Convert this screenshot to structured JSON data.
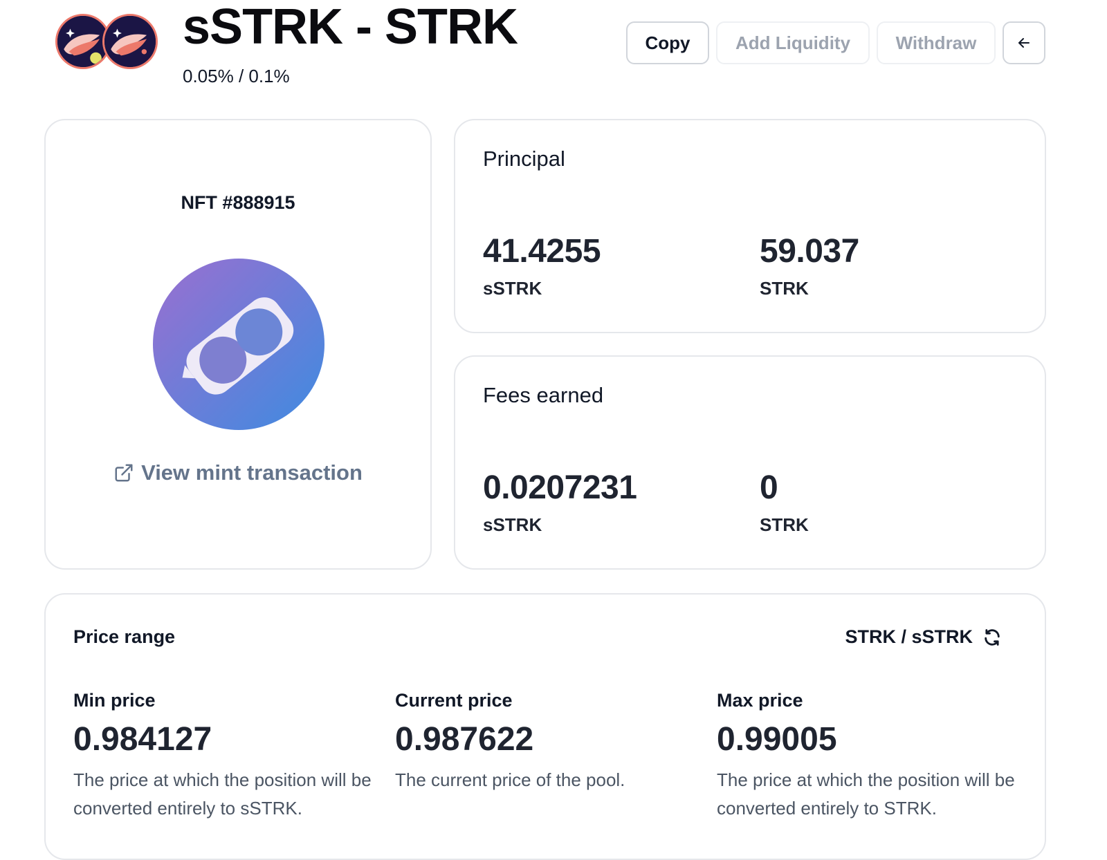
{
  "header": {
    "tokens": [
      {
        "name": "xSTRK-logo-icon"
      },
      {
        "name": "STRK-logo-icon"
      }
    ],
    "pair_title": "sSTRK - STRK",
    "fee_tier": "0.05% / 0.1%",
    "actions": {
      "copy": "Copy",
      "add_liquidity": "Add Liquidity",
      "withdraw": "Withdraw",
      "back_icon": "arrow-left-icon"
    }
  },
  "nft": {
    "title": "NFT #888915",
    "mint_link": "View mint transaction",
    "link_icon": "external-link-icon"
  },
  "principal": {
    "title": "Principal",
    "token_a": {
      "amount": "41.4255",
      "symbol": "sSTRK"
    },
    "token_b": {
      "amount": "59.037",
      "symbol": "STRK"
    }
  },
  "fees": {
    "title": "Fees earned",
    "token_a": {
      "amount": "0.0207231",
      "symbol": "sSTRK"
    },
    "token_b": {
      "amount": "0",
      "symbol": "STRK"
    }
  },
  "price_range": {
    "title": "Price range",
    "toggle_label": "STRK / sSTRK",
    "toggle_icon": "swap-refresh-icon",
    "min": {
      "label": "Min price",
      "value": "0.984127",
      "description": "The price at which the position will be converted entirely to sSTRK."
    },
    "current": {
      "label": "Current price",
      "value": "0.987622",
      "description": "The current price of the pool."
    },
    "max": {
      "label": "Max price",
      "value": "0.99005",
      "description": "The price at which the position will be converted entirely to STRK."
    }
  },
  "colors": {
    "accent_gradient_start": "#9b6fd0",
    "accent_gradient_end": "#3e8be0",
    "muted_text": "#64748b",
    "border": "#e5e7eb"
  }
}
